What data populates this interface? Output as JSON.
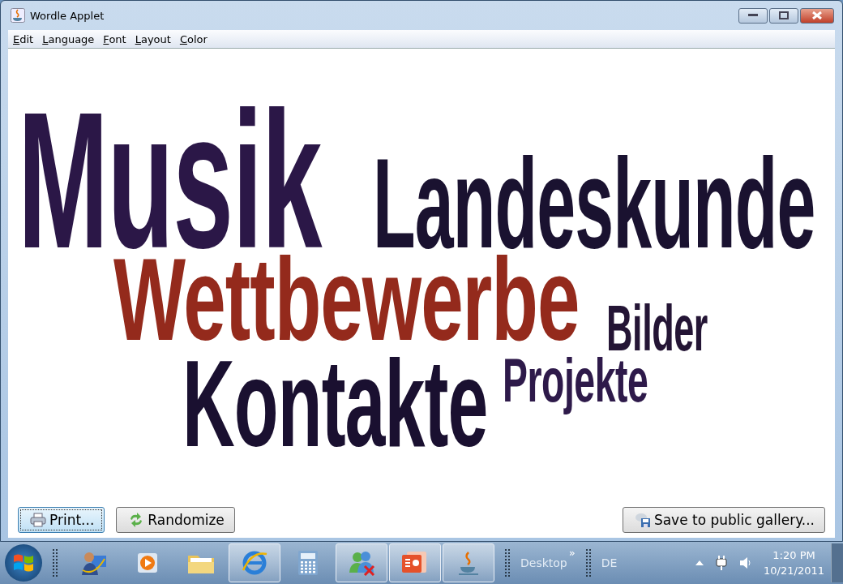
{
  "window": {
    "title": "Wordle Applet"
  },
  "menu": [
    "Edit",
    "Language",
    "Font",
    "Layout",
    "Color"
  ],
  "cloud": {
    "words": [
      {
        "text": "Musik",
        "color": "#2b1747"
      },
      {
        "text": "Landeskunde",
        "color": "#1a1230"
      },
      {
        "text": "Wettbewerbe",
        "color": "#942a1c"
      },
      {
        "text": "Bilder",
        "color": "#241535"
      },
      {
        "text": "Projekte",
        "color": "#2e1a4a"
      },
      {
        "text": "Kontakte",
        "color": "#1a1030"
      }
    ]
  },
  "buttons": [
    {
      "label": "Print...",
      "kind": "print",
      "focused": true
    },
    {
      "label": "Randomize",
      "kind": "randomize",
      "focused": false
    },
    {
      "label": "Save to public gallery...",
      "kind": "save",
      "focused": false
    }
  ],
  "taskbar": {
    "apps": [
      {
        "kind": "person",
        "running": false
      },
      {
        "kind": "media",
        "running": false
      },
      {
        "kind": "folder",
        "running": false
      },
      {
        "kind": "browser",
        "running": true
      },
      {
        "kind": "calculator",
        "running": false
      },
      {
        "kind": "people",
        "running": true
      },
      {
        "kind": "presentation",
        "running": true
      },
      {
        "kind": "java",
        "running": true
      }
    ],
    "toolbar": "Desktop",
    "toolbar_more": "»",
    "language": "DE",
    "time": "1:20 PM",
    "date": "10/21/2011"
  }
}
